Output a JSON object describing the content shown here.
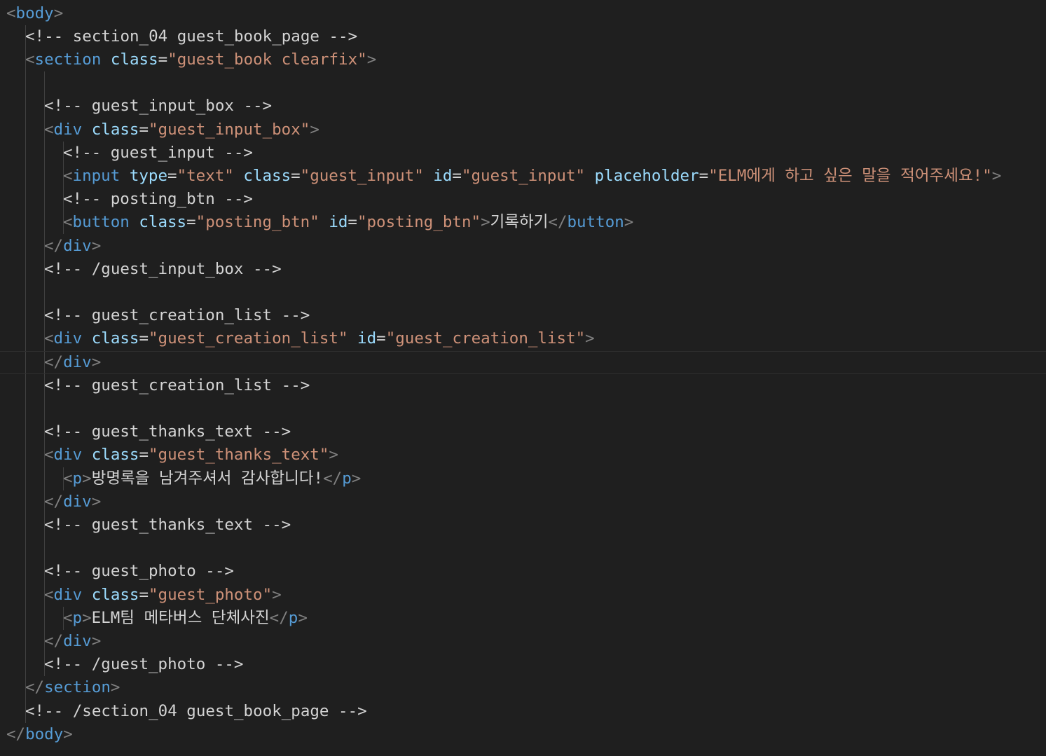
{
  "editor": {
    "theme_colors": {
      "background": "#1f1f1f",
      "tag": "#569cd6",
      "attribute": "#9cdcfe",
      "string": "#ce9178",
      "bracket": "#808080",
      "text": "#d4d4d4"
    },
    "current_line": 15,
    "lines": [
      {
        "indent": 0,
        "tokens": [
          [
            "b",
            "<"
          ],
          [
            "t",
            "body"
          ],
          [
            "b",
            ">"
          ]
        ]
      },
      {
        "indent": 1,
        "tokens": [
          [
            "c",
            "<!-- section_04 guest_book_page -->"
          ]
        ]
      },
      {
        "indent": 1,
        "tokens": [
          [
            "b",
            "<"
          ],
          [
            "t",
            "section"
          ],
          [
            "x",
            " "
          ],
          [
            "a",
            "class"
          ],
          [
            "e",
            "="
          ],
          [
            "s",
            "\"guest_book clearfix\""
          ],
          [
            "b",
            ">"
          ]
        ]
      },
      {
        "indent": 0,
        "tokens": []
      },
      {
        "indent": 2,
        "tokens": [
          [
            "c",
            "<!-- guest_input_box -->"
          ]
        ]
      },
      {
        "indent": 2,
        "tokens": [
          [
            "b",
            "<"
          ],
          [
            "t",
            "div"
          ],
          [
            "x",
            " "
          ],
          [
            "a",
            "class"
          ],
          [
            "e",
            "="
          ],
          [
            "s",
            "\"guest_input_box\""
          ],
          [
            "b",
            ">"
          ]
        ]
      },
      {
        "indent": 3,
        "tokens": [
          [
            "c",
            "<!-- guest_input -->"
          ]
        ]
      },
      {
        "indent": 3,
        "tokens": [
          [
            "b",
            "<"
          ],
          [
            "t",
            "input"
          ],
          [
            "x",
            " "
          ],
          [
            "a",
            "type"
          ],
          [
            "e",
            "="
          ],
          [
            "s",
            "\"text\""
          ],
          [
            "x",
            " "
          ],
          [
            "a",
            "class"
          ],
          [
            "e",
            "="
          ],
          [
            "s",
            "\"guest_input\""
          ],
          [
            "x",
            " "
          ],
          [
            "a",
            "id"
          ],
          [
            "e",
            "="
          ],
          [
            "s",
            "\"guest_input\""
          ],
          [
            "x",
            " "
          ],
          [
            "a",
            "placeholder"
          ],
          [
            "e",
            "="
          ],
          [
            "s",
            "\"ELM에게 하고 싶은 말을 적어주세요!\""
          ],
          [
            "b",
            ">"
          ]
        ]
      },
      {
        "indent": 3,
        "tokens": [
          [
            "c",
            "<!-- posting_btn -->"
          ]
        ]
      },
      {
        "indent": 3,
        "tokens": [
          [
            "b",
            "<"
          ],
          [
            "t",
            "button"
          ],
          [
            "x",
            " "
          ],
          [
            "a",
            "class"
          ],
          [
            "e",
            "="
          ],
          [
            "s",
            "\"posting_btn\""
          ],
          [
            "x",
            " "
          ],
          [
            "a",
            "id"
          ],
          [
            "e",
            "="
          ],
          [
            "s",
            "\"posting_btn\""
          ],
          [
            "b",
            ">"
          ],
          [
            "x",
            "기록하기"
          ],
          [
            "b",
            "</"
          ],
          [
            "t",
            "button"
          ],
          [
            "b",
            ">"
          ]
        ]
      },
      {
        "indent": 2,
        "tokens": [
          [
            "b",
            "</"
          ],
          [
            "t",
            "div"
          ],
          [
            "b",
            ">"
          ]
        ]
      },
      {
        "indent": 2,
        "tokens": [
          [
            "c",
            "<!-- /guest_input_box -->"
          ]
        ]
      },
      {
        "indent": 0,
        "tokens": []
      },
      {
        "indent": 2,
        "tokens": [
          [
            "c",
            "<!-- guest_creation_list -->"
          ]
        ]
      },
      {
        "indent": 2,
        "tokens": [
          [
            "b",
            "<"
          ],
          [
            "t",
            "div"
          ],
          [
            "x",
            " "
          ],
          [
            "a",
            "class"
          ],
          [
            "e",
            "="
          ],
          [
            "s",
            "\"guest_creation_list\""
          ],
          [
            "x",
            " "
          ],
          [
            "a",
            "id"
          ],
          [
            "e",
            "="
          ],
          [
            "s",
            "\"guest_creation_list\""
          ],
          [
            "b",
            ">"
          ]
        ]
      },
      {
        "indent": 2,
        "tokens": [
          [
            "b",
            "</"
          ],
          [
            "t",
            "div"
          ],
          [
            "b",
            ">"
          ]
        ]
      },
      {
        "indent": 2,
        "tokens": [
          [
            "c",
            "<!-- guest_creation_list -->"
          ]
        ]
      },
      {
        "indent": 0,
        "tokens": []
      },
      {
        "indent": 2,
        "tokens": [
          [
            "c",
            "<!-- guest_thanks_text -->"
          ]
        ]
      },
      {
        "indent": 2,
        "tokens": [
          [
            "b",
            "<"
          ],
          [
            "t",
            "div"
          ],
          [
            "x",
            " "
          ],
          [
            "a",
            "class"
          ],
          [
            "e",
            "="
          ],
          [
            "s",
            "\"guest_thanks_text\""
          ],
          [
            "b",
            ">"
          ]
        ]
      },
      {
        "indent": 3,
        "tokens": [
          [
            "b",
            "<"
          ],
          [
            "t",
            "p"
          ],
          [
            "b",
            ">"
          ],
          [
            "x",
            "방명록을 남겨주셔서 감사합니다!"
          ],
          [
            "b",
            "</"
          ],
          [
            "t",
            "p"
          ],
          [
            "b",
            ">"
          ]
        ]
      },
      {
        "indent": 2,
        "tokens": [
          [
            "b",
            "</"
          ],
          [
            "t",
            "div"
          ],
          [
            "b",
            ">"
          ]
        ]
      },
      {
        "indent": 2,
        "tokens": [
          [
            "c",
            "<!-- guest_thanks_text -->"
          ]
        ]
      },
      {
        "indent": 0,
        "tokens": []
      },
      {
        "indent": 2,
        "tokens": [
          [
            "c",
            "<!-- guest_photo -->"
          ]
        ]
      },
      {
        "indent": 2,
        "tokens": [
          [
            "b",
            "<"
          ],
          [
            "t",
            "div"
          ],
          [
            "x",
            " "
          ],
          [
            "a",
            "class"
          ],
          [
            "e",
            "="
          ],
          [
            "s",
            "\"guest_photo\""
          ],
          [
            "b",
            ">"
          ]
        ]
      },
      {
        "indent": 3,
        "tokens": [
          [
            "b",
            "<"
          ],
          [
            "t",
            "p"
          ],
          [
            "b",
            ">"
          ],
          [
            "x",
            "ELM팀 메타버스 단체사진"
          ],
          [
            "b",
            "</"
          ],
          [
            "t",
            "p"
          ],
          [
            "b",
            ">"
          ]
        ]
      },
      {
        "indent": 2,
        "tokens": [
          [
            "b",
            "</"
          ],
          [
            "t",
            "div"
          ],
          [
            "b",
            ">"
          ]
        ]
      },
      {
        "indent": 2,
        "tokens": [
          [
            "c",
            "<!-- /guest_photo -->"
          ]
        ]
      },
      {
        "indent": 1,
        "tokens": [
          [
            "b",
            "</"
          ],
          [
            "t",
            "section"
          ],
          [
            "b",
            ">"
          ]
        ]
      },
      {
        "indent": 1,
        "tokens": [
          [
            "c",
            "<!-- /section_04 guest_book_page -->"
          ]
        ]
      },
      {
        "indent": 0,
        "tokens": [
          [
            "b",
            "</"
          ],
          [
            "t",
            "body"
          ],
          [
            "b",
            ">"
          ]
        ]
      }
    ]
  }
}
